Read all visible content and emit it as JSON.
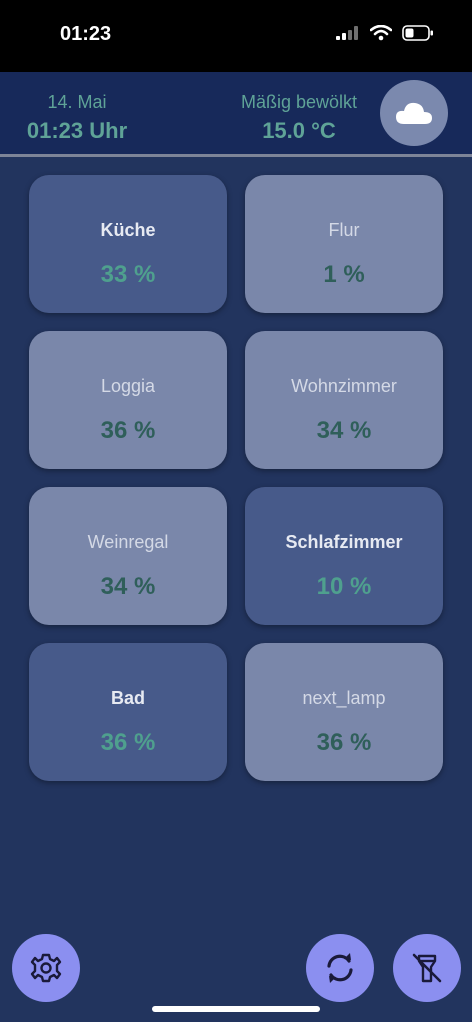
{
  "status_bar": {
    "time": "01:23"
  },
  "header": {
    "date": "14. Mai",
    "clock": "01:23 Uhr",
    "weather_text": "Mäßig bewölkt",
    "temperature": "15.0 °C",
    "weather_icon": "cloud-icon"
  },
  "rooms": [
    {
      "name": "Küche",
      "value": "33 %",
      "state": "on"
    },
    {
      "name": "Flur",
      "value": "1 %",
      "state": "off"
    },
    {
      "name": "Loggia",
      "value": "36 %",
      "state": "off"
    },
    {
      "name": "Wohnzimmer",
      "value": "34 %",
      "state": "off"
    },
    {
      "name": "Weinregal",
      "value": "34 %",
      "state": "off"
    },
    {
      "name": "Schlafzimmer",
      "value": "10 %",
      "state": "on"
    },
    {
      "name": "Bad",
      "value": "36 %",
      "state": "on"
    },
    {
      "name": "next_lamp",
      "value": "36 %",
      "state": "off"
    }
  ],
  "buttons": {
    "settings_icon": "gear-icon",
    "refresh_icon": "refresh-icon",
    "flashlight_icon": "flashlight-off-icon"
  },
  "colors": {
    "background": "#22345e",
    "header": "#17295a",
    "tile_on": "#475a8a",
    "tile_off": "#7a87aa",
    "accent_text": "#5fa397",
    "fab": "#8b8ff0"
  }
}
